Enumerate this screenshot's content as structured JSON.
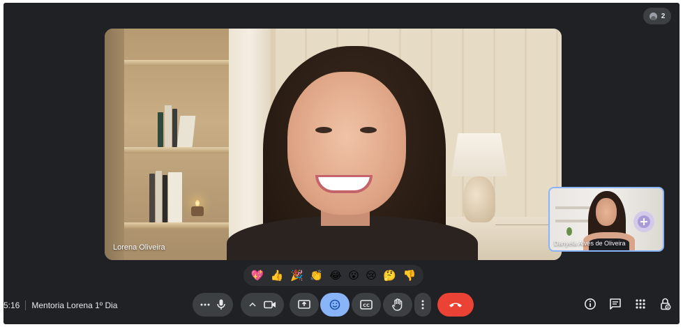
{
  "participants": {
    "count": "2"
  },
  "main_tile": {
    "name": "Lorena Oliveira"
  },
  "self_tile": {
    "name": "Danyela Alves de Oliveira"
  },
  "reactions": [
    {
      "icon": "sparkling-heart",
      "glyph": "💖"
    },
    {
      "icon": "thumbs-up",
      "glyph": "👍"
    },
    {
      "icon": "party-popper",
      "glyph": "🎉"
    },
    {
      "icon": "clapping-hands",
      "glyph": "👏"
    },
    {
      "icon": "joy",
      "glyph": "😂"
    },
    {
      "icon": "open-mouth",
      "glyph": "😮"
    },
    {
      "icon": "crying-face",
      "glyph": "😢"
    },
    {
      "icon": "thinking-face",
      "glyph": "🤔"
    },
    {
      "icon": "thumbs-down",
      "glyph": "👎"
    }
  ],
  "meeting": {
    "time": "5:16",
    "title": "Mentoria Lorena 1º Dia"
  },
  "controls": {
    "more_audio": "more-options-icon",
    "mic": "microphone-icon",
    "camera_options": "chevron-up-icon",
    "camera": "camera-icon",
    "present": "present-screen-icon",
    "reactions": "emoji-icon",
    "captions": "closed-captions-icon",
    "raise_hand": "raise-hand-icon",
    "more": "more-vert-icon",
    "leave": "end-call-icon"
  },
  "colors": {
    "background": "#202124",
    "control": "#3c4043",
    "active": "#8ab4f8",
    "end_call": "#ea4335",
    "self_border": "#8ab4f8"
  }
}
